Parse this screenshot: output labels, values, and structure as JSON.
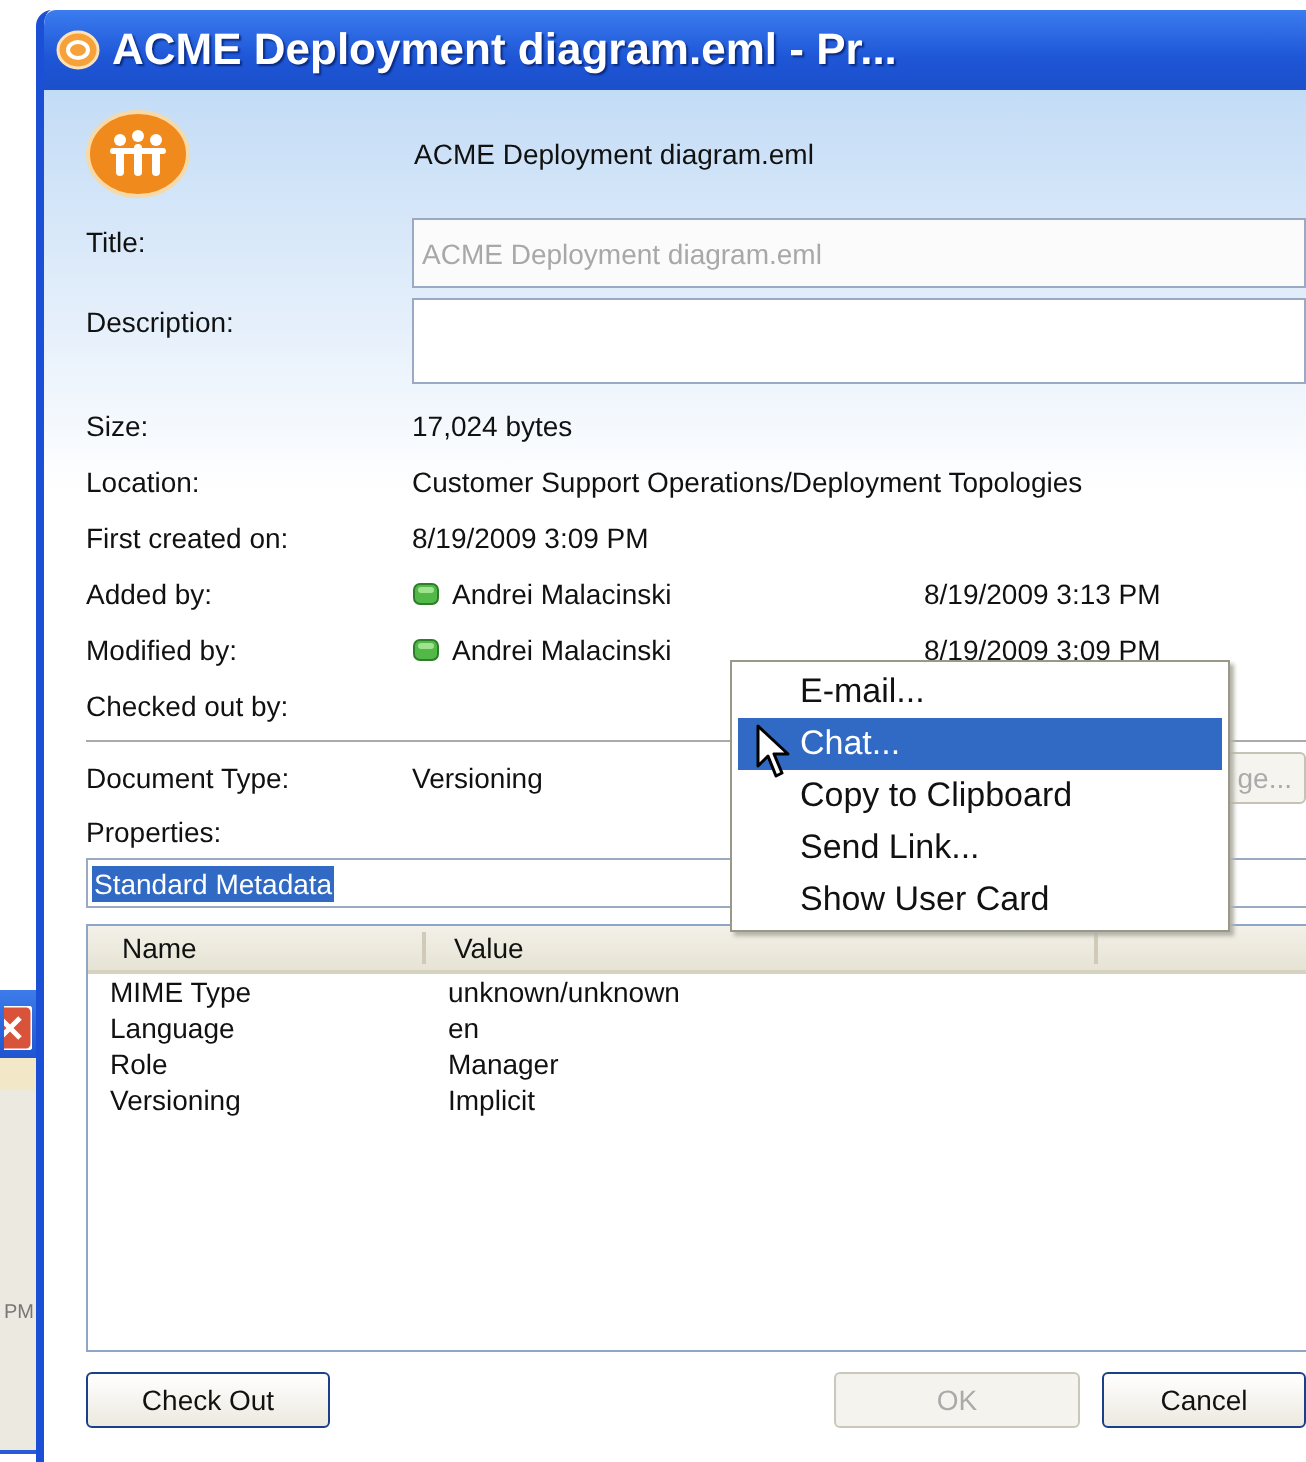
{
  "background_window": {
    "time_fragment": "PM"
  },
  "window": {
    "title": "ACME Deployment diagram.eml - Pr..."
  },
  "header": {
    "filename": "ACME Deployment diagram.eml"
  },
  "title_field": {
    "label": "Title:",
    "value": "ACME Deployment diagram.eml",
    "disabled": true
  },
  "description_field": {
    "label": "Description:"
  },
  "details": [
    {
      "kind": "text",
      "label": "Size:",
      "value": "17,024 bytes"
    },
    {
      "kind": "text",
      "label": "Location:",
      "value": "Customer Support Operations/Deployment Topologies"
    },
    {
      "kind": "text",
      "label": "First created on:",
      "value": "8/19/2009 3:09 PM"
    },
    {
      "kind": "person",
      "label": "Added by:",
      "value": "Andrei Malacinski",
      "date": "8/19/2009 3:13 PM"
    },
    {
      "kind": "person",
      "label": "Modified by:",
      "value": "Andrei Malacinski",
      "date": "8/19/2009 3:09 PM"
    },
    {
      "kind": "text",
      "label": "Checked out by:"
    }
  ],
  "document_type": {
    "label": "Document Type:",
    "value": "Versioning",
    "button": {
      "label": "ge...",
      "disabled": true
    }
  },
  "properties": {
    "label": "Properties:",
    "selection": "Standard Metadata"
  },
  "table": {
    "columns": [
      "Name",
      "Value"
    ],
    "rows": [
      [
        "MIME Type",
        "unknown/unknown"
      ],
      [
        "Language",
        "en"
      ],
      [
        "Role",
        "Manager"
      ],
      [
        "Versioning",
        "Implicit"
      ]
    ]
  },
  "context_menu": {
    "items": [
      {
        "label": "E-mail...",
        "selected": false
      },
      {
        "label": "Chat...",
        "selected": true
      },
      {
        "label": "Copy to Clipboard",
        "selected": false
      },
      {
        "label": "Send Link...",
        "selected": false
      },
      {
        "label": "Show User Card",
        "selected": false
      }
    ]
  },
  "buttons": [
    {
      "label": "Check Out",
      "disabled": false
    },
    {
      "label": "OK",
      "disabled": true
    },
    {
      "label": "Cancel",
      "disabled": false
    }
  ]
}
